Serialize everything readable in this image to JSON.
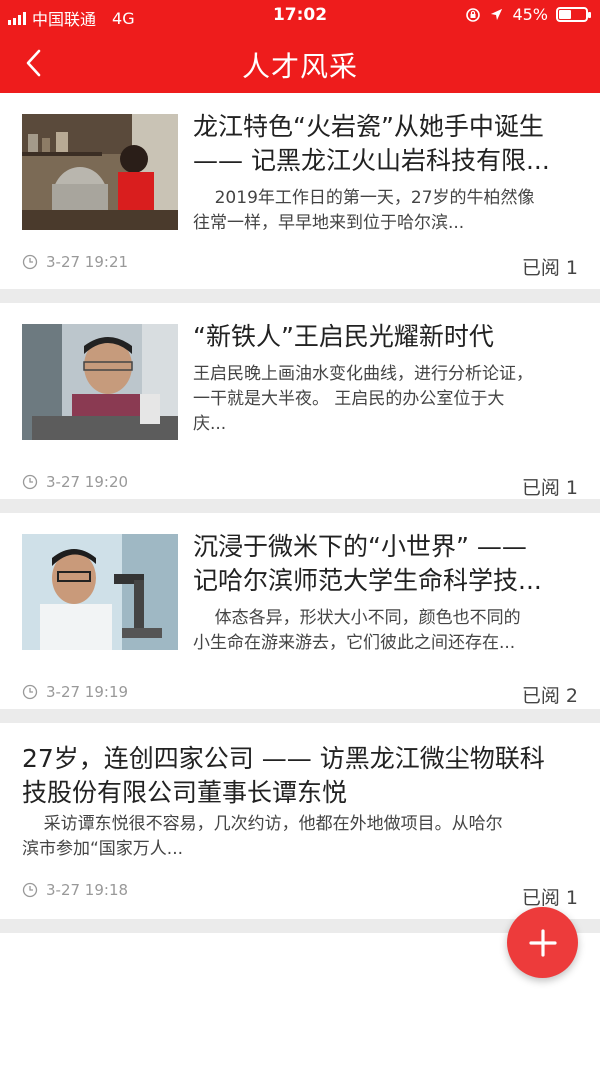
{
  "status_bar": {
    "carrier": "中国联通",
    "network": "4G",
    "time": "17:02",
    "battery": "45%"
  },
  "nav": {
    "title": "人才风采"
  },
  "articles": [
    {
      "title_line1": "龙江特色“火岩瓷”从她手中诞生",
      "title_line2": "—— 记黑龙江火山岩科技有限...",
      "summary_line1": "    2019年工作日的第一天，27岁的牛柏然像",
      "summary_line2": "往常一样，早早地来到位于哈尔滨...",
      "time": "3-27 19:21",
      "read": "已阅 1"
    },
    {
      "title_line1": "“新铁人”王启民光耀新时代",
      "summary_line1": "王启民晚上画油水变化曲线，进行分析论证，",
      "summary_line2": "一干就是大半夜。 王启民的办公室位于大",
      "summary_line3": "庆...",
      "time": "3-27 19:20",
      "read": "已阅 1"
    },
    {
      "title_line1": "沉浸于微米下的“小世界” ——",
      "title_line2": "记哈尔滨师范大学生命科学技...",
      "summary_line1": "    体态各异，形状大小不同，颜色也不同的",
      "summary_line2": "小生命在游来游去，它们彼此之间还存在...",
      "time": "3-27 19:19",
      "read": "已阅 2"
    },
    {
      "title_line1": "27岁，连创四家公司 —— 访黑龙江微尘物联科",
      "title_line2": "技股份有限公司董事长谭东悦",
      "summary_line1": "    采访谭东悦很不容易，几次约访，他都在外地做项目。从哈尔",
      "summary_line2": "滨市参加“国家万人...",
      "time": "3-27 19:18",
      "read": "已阅 1"
    }
  ],
  "colors": {
    "brand_red": "#ee1c1c",
    "fab_red": "#ed3b3b",
    "separator": "#ebebeb"
  },
  "icons": {
    "back": "chevron-left-icon",
    "clock": "clock-icon",
    "fab": "plus-icon"
  }
}
